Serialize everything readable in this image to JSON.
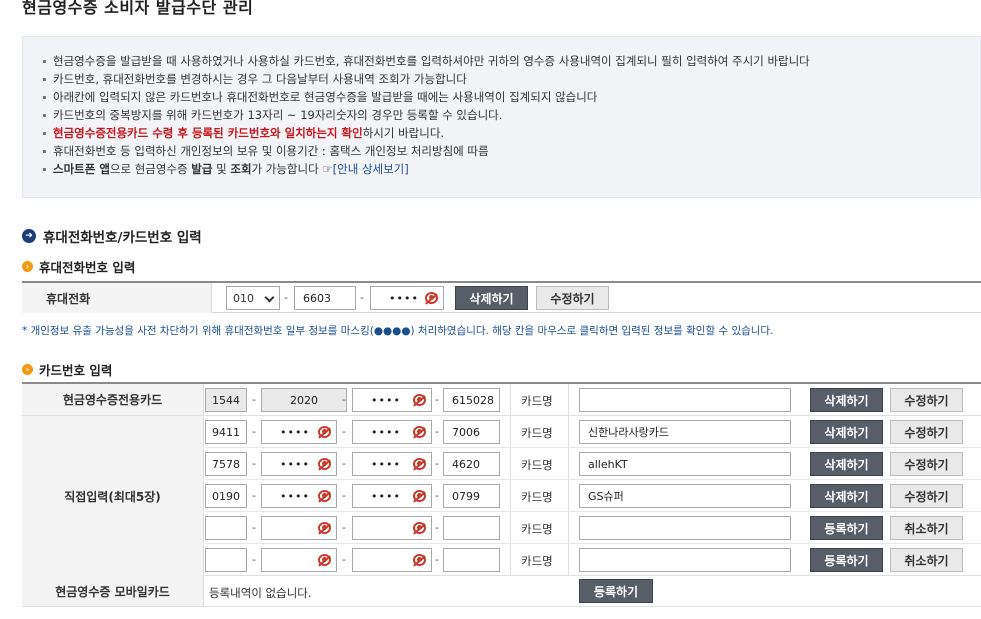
{
  "page_title": "현금영수증 소비자 발급수단 관리",
  "notice": {
    "items": [
      "현금영수증을 발급받을 때 사용하였거나 사용하실 카드번호, 휴대전화번호를 입력하셔야만 귀하의 영수증 사용내역이 집계되니 필히 입력하여 주시기 바랍니다",
      "카드번호, 휴대전화번호를 변경하시는 경우 그 다음날부터 사용내역 조회가 가능합니다",
      "아래칸에 입력되지 않은 카드번호나 휴대전화번호로 현금영수증을 발급받을 때에는 사용내역이 집계되지 않습니다",
      "카드번호의 중복방지를 위해 카드번호가 13자리 ~ 19자리숫자의 경우만 등록할 수 있습니다."
    ],
    "item5_red": "현금영수증전용카드 수령 후 등록된 카드번호와 일치하는지 확인",
    "item5_rest": "하시기 바랍니다.",
    "item6": "휴대전화번호 등 입력하신 개인정보의 보유 및 이용기간 : 홈택스 개인정보 처리방침에 따름",
    "item7_a": "스마트폰 앱",
    "item7_b": "으로 현금영수증 ",
    "item7_c": "발급",
    "item7_d": " 및 ",
    "item7_e": "조회",
    "item7_f": "가 가능합니다 ",
    "item7_link_icon": "☞",
    "item7_link": "[안내 상세보기]"
  },
  "section_title": "휴대전화번호/카드번호 입력",
  "phone": {
    "subtitle": "휴대전화번호 입력",
    "label": "휴대전화",
    "prefix": "010",
    "middle": "6603",
    "last_masked": "••••",
    "dash": "-",
    "delete_label": "삭제하기",
    "edit_label": "수정하기"
  },
  "mask_note": "* 개인정보 유출 가능성을 사전 차단하기 위해 휴대전화번호 일부 정보를 마스킹(●●●●) 처리하였습니다. 해당 칸을 마우스로 클릭하면 입력된 정보를 확인할 수 있습니다.",
  "card": {
    "subtitle": "카드번호 입력",
    "name_label": "카드명",
    "dash": "-",
    "masked": "••••",
    "dedicated": {
      "label": "현금영수증전용카드",
      "part1": "1544",
      "part2": "2020",
      "part4": "615028",
      "name": "",
      "delete_label": "삭제하기",
      "edit_label": "수정하기"
    },
    "direct_label": "직접입력(최대5장)",
    "direct_rows": [
      {
        "part1": "9411",
        "part4": "7006",
        "name": "신한나라사랑카드",
        "btn1": "삭제하기",
        "btn2": "수정하기"
      },
      {
        "part1": "7578",
        "part4": "4620",
        "name": "allehKT",
        "btn1": "삭제하기",
        "btn2": "수정하기"
      },
      {
        "part1": "0190",
        "part4": "0799",
        "name": "GS슈퍼",
        "btn1": "삭제하기",
        "btn2": "수정하기"
      },
      {
        "part1": "",
        "part4": "",
        "name": "",
        "btn1": "등록하기",
        "btn2": "취소하기"
      },
      {
        "part1": "",
        "part4": "",
        "name": "",
        "btn1": "등록하기",
        "btn2": "취소하기"
      }
    ],
    "mobile": {
      "label": "현금영수증 모바일카드",
      "status": "등록내역이 없습니다.",
      "register_label": "등록하기"
    }
  },
  "colors": {
    "accent_red": "#c8171c",
    "dark_button": "#575e68",
    "notice_bg": "#f2f4f8",
    "link_blue": "#1c4c9c"
  }
}
